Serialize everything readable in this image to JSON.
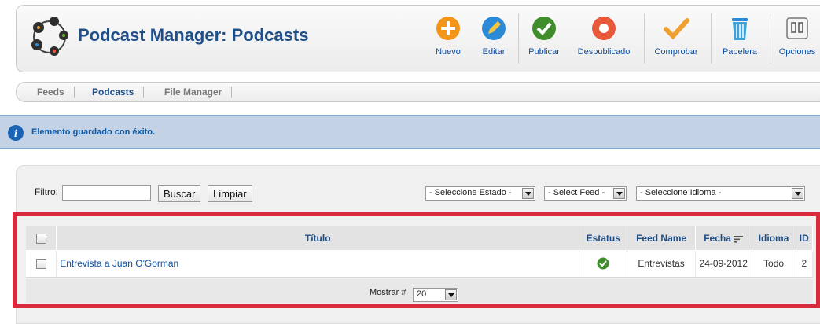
{
  "header": {
    "title": "Podcast Manager: Podcasts",
    "toolbar": [
      {
        "label": "Nuevo",
        "icon": "plus-circle-icon",
        "color": "#f39519"
      },
      {
        "label": "Editar",
        "icon": "pencil-circle-icon",
        "color": "#2a8ad8"
      },
      {
        "label": "Publicar",
        "icon": "check-circle-icon",
        "color": "#3f8d2b"
      },
      {
        "label": "Despublicado",
        "icon": "unpublish-circle-icon",
        "color": "#e8593a"
      },
      {
        "label": "Comprobar",
        "icon": "checkmark-icon",
        "color": "#f0a030"
      },
      {
        "label": "Papelera",
        "icon": "trash-icon",
        "color": "#3aa3dc"
      },
      {
        "label": "Opciones",
        "icon": "options-icon",
        "color": "#666666"
      }
    ]
  },
  "submenu": {
    "items": [
      "Feeds",
      "Podcasts",
      "File Manager"
    ],
    "active": "Podcasts"
  },
  "message": {
    "text": "Elemento guardado con éxito.",
    "icon": "info-icon"
  },
  "filter": {
    "label": "Filtro:",
    "value": "",
    "search_button": "Buscar",
    "clear_button": "Limpiar",
    "state_select": "- Seleccione Estado -",
    "feed_select": "- Select Feed -",
    "language_select": "- Seleccione Idioma -"
  },
  "table": {
    "columns": [
      "Título",
      "Estatus",
      "Feed Name",
      "Fecha",
      "Idioma",
      "ID"
    ],
    "rows": [
      {
        "title": "Entrevista a Juan O'Gorman",
        "status": "published",
        "feed": "Entrevistas",
        "date": "24-09-2012",
        "language": "Todo",
        "id": "2"
      }
    ],
    "footer": {
      "label": "Mostrar #",
      "value": "20"
    }
  },
  "colors": {
    "accent": "#1f4f86",
    "link": "#0b4ea2",
    "message_bg": "#c3d2e5",
    "highlight": "#d52b3b"
  }
}
